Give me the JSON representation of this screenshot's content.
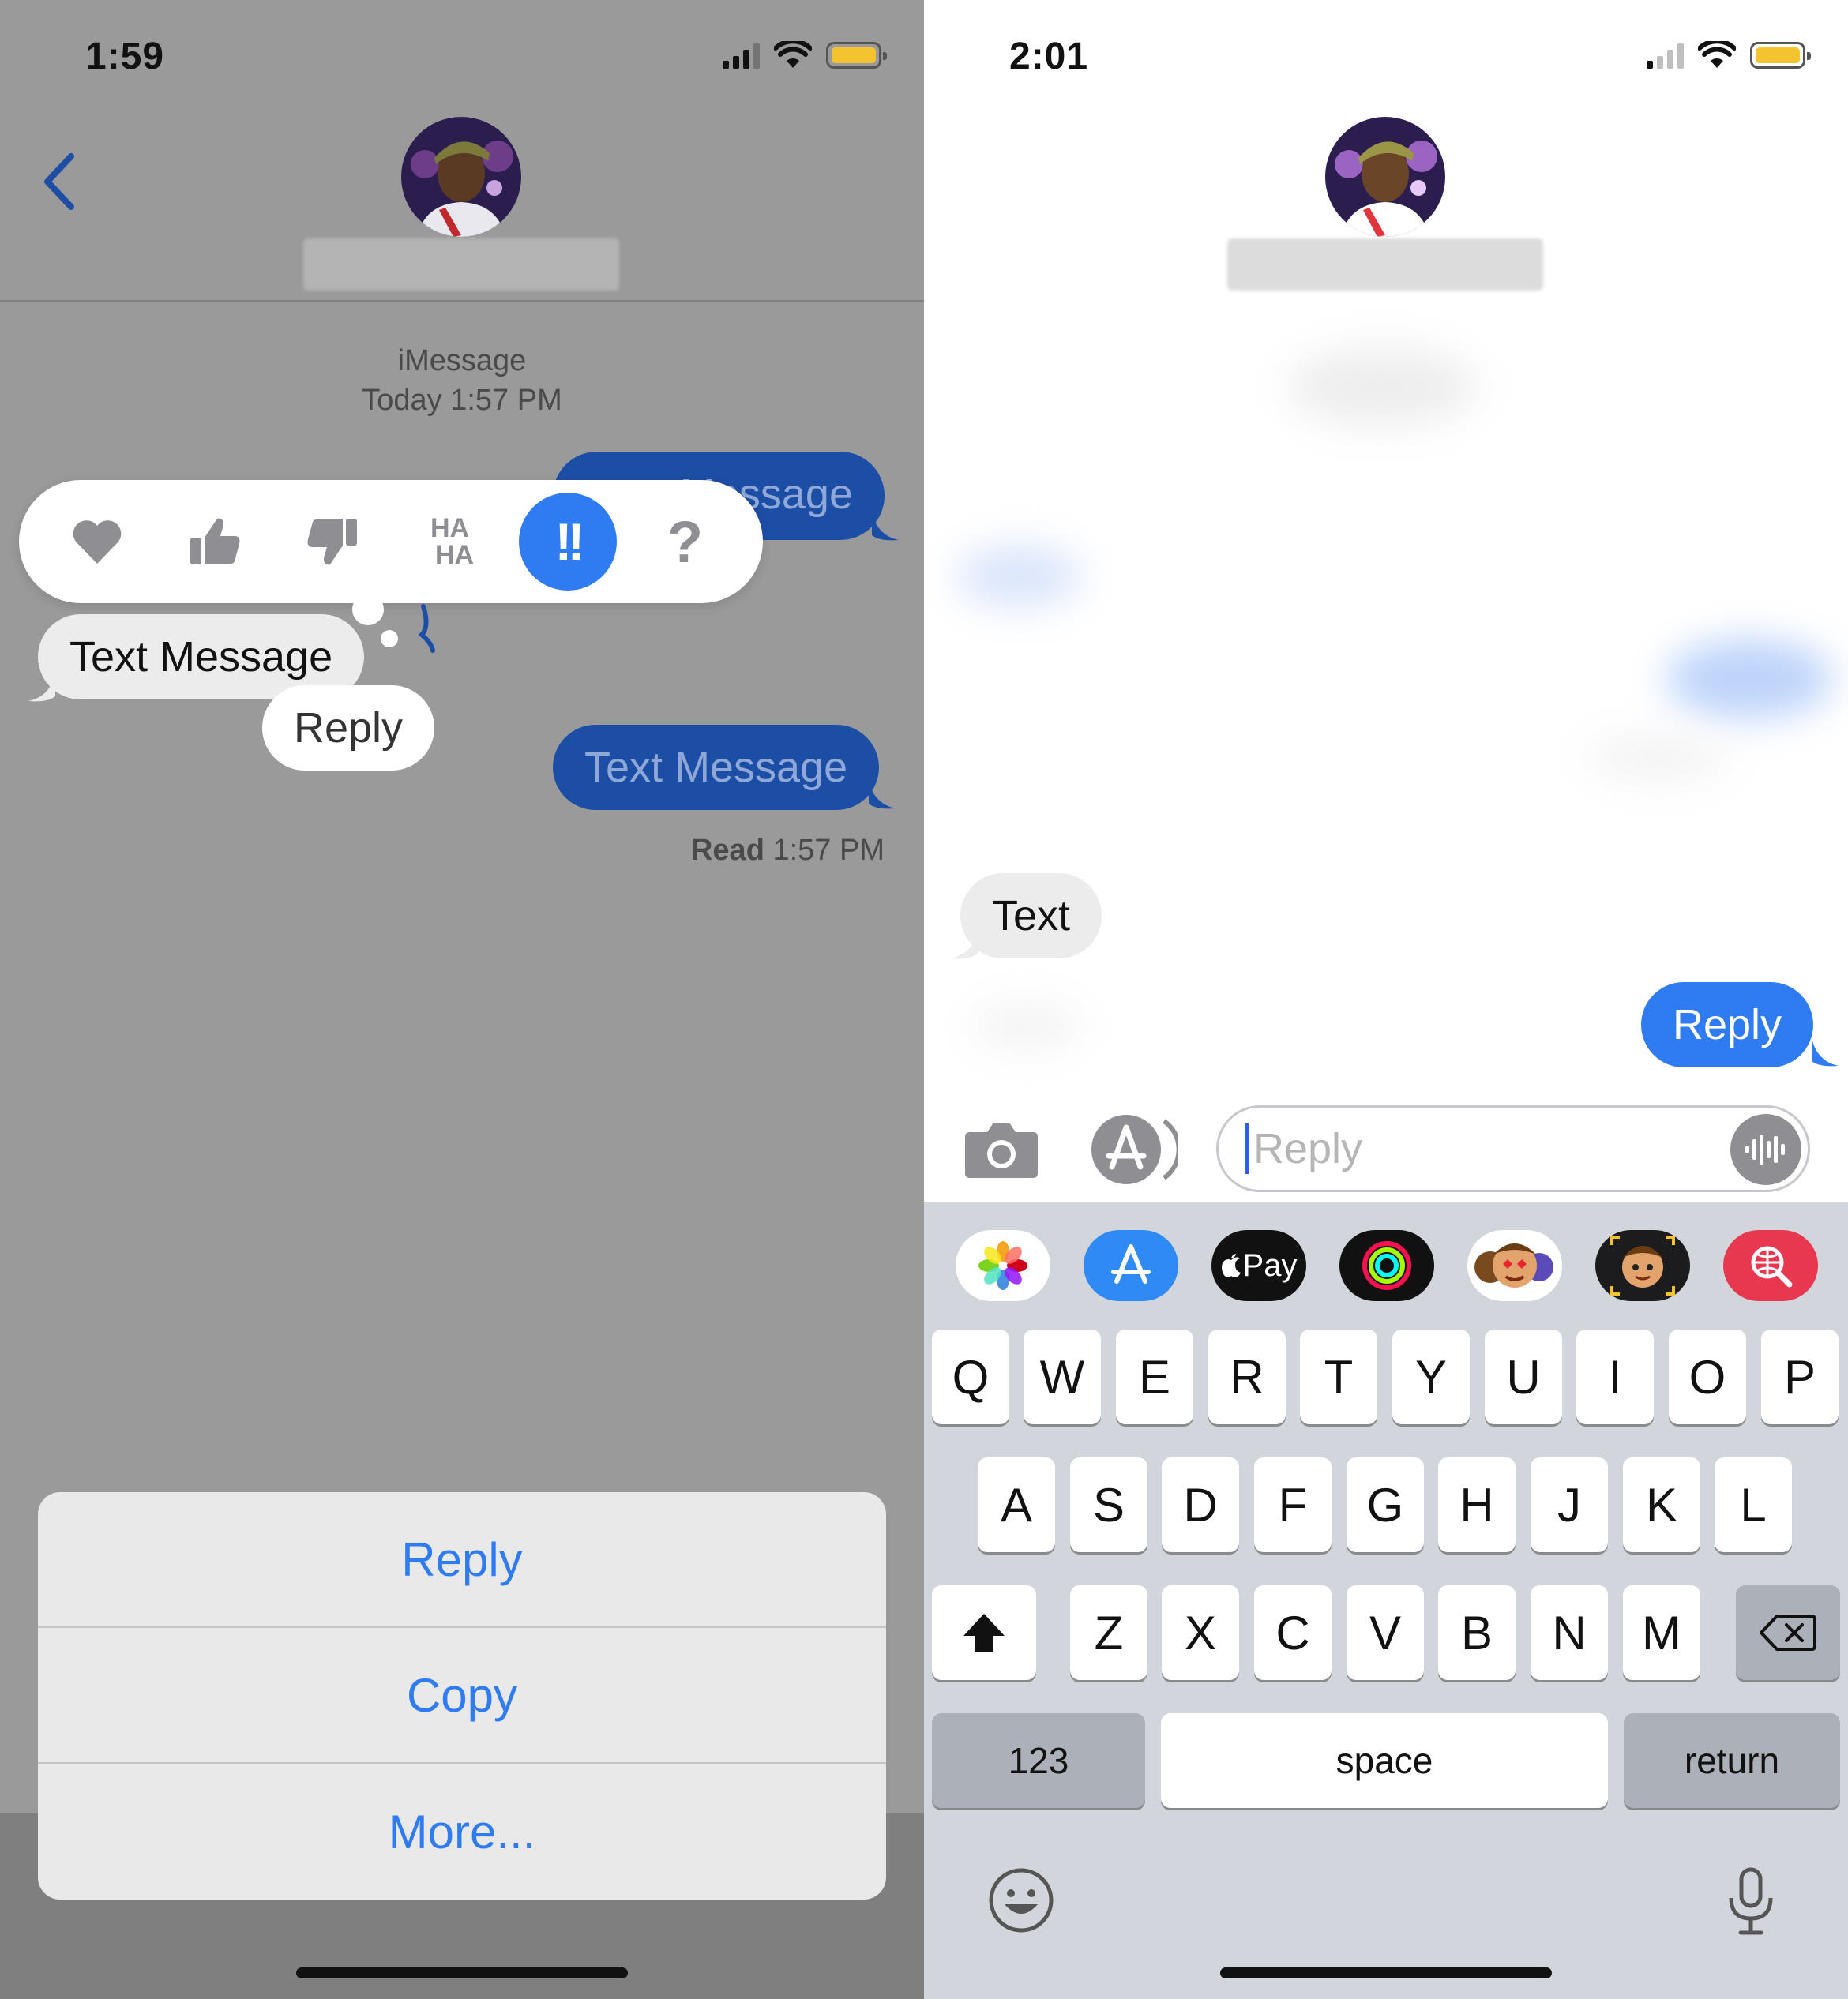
{
  "left": {
    "status": {
      "time": "1:59"
    },
    "timestamp": {
      "service": "iMessage",
      "when": "Today 1:57 PM"
    },
    "messages": {
      "out_top": "Message",
      "in_main": "Text Message",
      "reply_preview": "Reply",
      "out_bottom": "Text Message"
    },
    "read_receipt": {
      "label": "Read",
      "time": "1:57 PM"
    },
    "tapbacks": [
      "heart-icon",
      "thumbs-up-icon",
      "thumbs-down-icon",
      "haha-icon",
      "exclamation-icon",
      "question-icon"
    ],
    "tapback_haha": {
      "line1": "HA",
      "line2": "HA"
    },
    "tapback_question": "?",
    "tapback_exclaim": "!!",
    "action_sheet": {
      "reply": "Reply",
      "copy": "Copy",
      "more": "More..."
    }
  },
  "right": {
    "status": {
      "time": "2:01"
    },
    "messages": {
      "in_text": "Text",
      "out_reply": "Reply"
    },
    "input": {
      "placeholder": "Reply"
    },
    "apps": [
      "photos-app-icon",
      "app-store-icon",
      "apple-pay-icon",
      "activity-icon",
      "memoji-stickers-icon",
      "animoji-icon",
      "web-search-icon"
    ],
    "apple_pay_label": "Pay",
    "keyboard": {
      "row1": [
        "Q",
        "W",
        "E",
        "R",
        "T",
        "Y",
        "U",
        "I",
        "O",
        "P"
      ],
      "row2": [
        "A",
        "S",
        "D",
        "F",
        "G",
        "H",
        "J",
        "K",
        "L"
      ],
      "row3": [
        "Z",
        "X",
        "C",
        "V",
        "B",
        "N",
        "M"
      ],
      "numbers": "123",
      "space": "space",
      "return": "return"
    }
  },
  "colors": {
    "imessage_blue": "#2f7bf2",
    "dimmed_bg": "#9a9a9a",
    "keyboard_bg": "#d2d5db"
  }
}
